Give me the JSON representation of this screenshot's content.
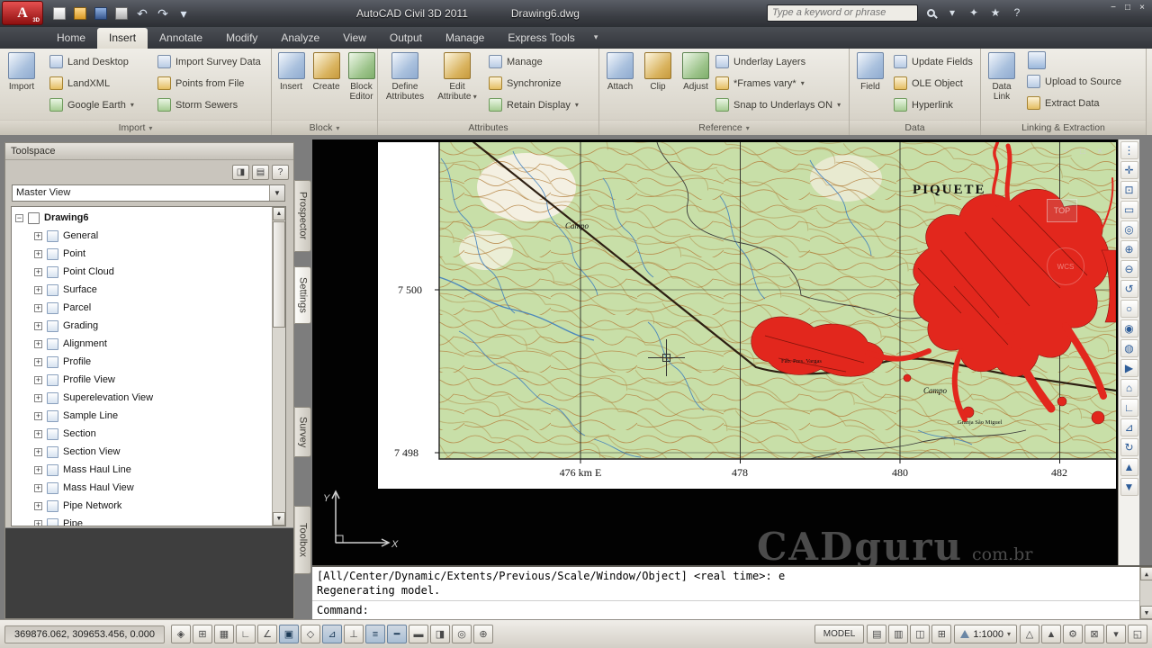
{
  "titlebar": {
    "app_title": "AutoCAD Civil 3D 2011",
    "doc_title": "Drawing6.dwg",
    "app_logo_letter": "A",
    "app_badge": "3D",
    "search_placeholder": "Type a keyword or phrase",
    "qat": [
      {
        "name": "qat-new-button",
        "kind": "new"
      },
      {
        "name": "qat-open-button",
        "kind": "open"
      },
      {
        "name": "qat-save-button",
        "kind": "save"
      },
      {
        "name": "qat-plot-button",
        "kind": "plot"
      },
      {
        "name": "qat-undo-button",
        "glyph": "↶"
      },
      {
        "name": "qat-redo-button",
        "glyph": "↷"
      },
      {
        "name": "qat-customize-caret",
        "glyph": "▾"
      }
    ],
    "infocenter": [
      {
        "name": "search-go-button",
        "kind": "mag"
      },
      {
        "name": "search-caret",
        "glyph": "▾"
      },
      {
        "name": "communication-center-button",
        "glyph": "✦"
      },
      {
        "name": "favorites-button",
        "glyph": "★"
      },
      {
        "name": "help-button",
        "glyph": "?"
      }
    ],
    "window_buttons": [
      {
        "name": "window-minimize-button",
        "glyph": "−"
      },
      {
        "name": "window-restore-button",
        "glyph": "□"
      },
      {
        "name": "window-close-button",
        "glyph": "×"
      }
    ]
  },
  "ribbon": {
    "tabs": [
      "Home",
      "Insert",
      "Annotate",
      "Modify",
      "Analyze",
      "View",
      "Output",
      "Manage",
      "Express Tools"
    ],
    "active_tab": "Insert",
    "panels": {
      "import": {
        "footer": "Import",
        "big": {
          "label": "Import"
        },
        "col1": [
          {
            "label": "Land Desktop"
          },
          {
            "label": "LandXML"
          },
          {
            "label": "Google Earth",
            "caret": true
          }
        ],
        "col2": [
          {
            "label": "Import Survey Data"
          },
          {
            "label": "Points from File"
          },
          {
            "label": "Storm Sewers"
          }
        ]
      },
      "block": {
        "footer": "Block",
        "bigs": [
          {
            "label": "Insert"
          },
          {
            "label": "Create"
          },
          {
            "label": "Block Editor"
          }
        ]
      },
      "attributes": {
        "footer": "Attributes",
        "bigs": [
          {
            "label": "Define Attributes"
          },
          {
            "label": "Edit Attribute",
            "caret": true
          }
        ],
        "col": [
          {
            "label": "Manage"
          },
          {
            "label": "Synchronize"
          },
          {
            "label": "Retain Display",
            "caret": true
          }
        ]
      },
      "reference": {
        "footer": "Reference",
        "bigs": [
          {
            "label": "Attach"
          },
          {
            "label": "Clip"
          },
          {
            "label": "Adjust"
          }
        ],
        "col": [
          {
            "label": "Underlay Layers"
          },
          {
            "label": "*Frames vary*",
            "caret": true
          },
          {
            "label": "Snap to Underlays ON",
            "caret": true
          }
        ]
      },
      "data": {
        "footer": "Data",
        "bigs": [
          {
            "label": "Field"
          }
        ],
        "col": [
          {
            "label": "Update Fields"
          },
          {
            "label": "OLE Object"
          },
          {
            "label": "Hyperlink"
          }
        ]
      },
      "linking": {
        "footer": "Linking & Extraction",
        "bigs": [
          {
            "label": "Data Link"
          }
        ],
        "col": [
          {
            "label": "Upload to Source"
          },
          {
            "label": "Extract Data"
          }
        ]
      }
    }
  },
  "toolspace": {
    "title": "Toolspace",
    "buttons": [
      {
        "name": "toolspace-autohide-button",
        "glyph": "◨"
      },
      {
        "name": "toolspace-properties-button",
        "glyph": "▤"
      },
      {
        "name": "toolspace-help-button",
        "glyph": "?"
      }
    ],
    "view_selector": "Master View",
    "root": "Drawing6",
    "items": [
      "General",
      "Point",
      "Point Cloud",
      "Surface",
      "Parcel",
      "Grading",
      "Alignment",
      "Profile",
      "Profile View",
      "Superelevation View",
      "Sample Line",
      "Section",
      "Section View",
      "Mass Haul Line",
      "Mass Haul View",
      "Pipe Network",
      "Pipe"
    ],
    "tabs": [
      {
        "label": "Prospector"
      },
      {
        "label": "Settings",
        "active": true
      },
      {
        "label": "Survey"
      },
      {
        "label": "Toolbox"
      }
    ]
  },
  "canvas": {
    "window_buttons": [
      {
        "name": "drawing-minimize-button",
        "glyph": "−"
      },
      {
        "name": "drawing-restore-button",
        "glyph": "□"
      },
      {
        "name": "drawing-close-button",
        "glyph": "×"
      }
    ],
    "viewcube_label": "TOP",
    "wcs_label": "WCS",
    "ucs_x": "X",
    "ucs_y": "Y",
    "watermark_main": "CADguru",
    "watermark_suffix": "com.br",
    "map": {
      "place_city": "PIQUETE",
      "place_campo_1": "Campo",
      "place_campo_2": "Campo",
      "place_granja": "Granja São Miguel",
      "place_vargas": "Fáb. Pres. Vargas",
      "grid_y_1": "7 500",
      "grid_y_2": "7 498",
      "grid_x_1": "476 km E",
      "grid_x_2": "478",
      "grid_x_3": "480",
      "grid_x_4": "482"
    }
  },
  "navbar": {
    "items": [
      {
        "name": "navbar-grip",
        "glyph": "⋮"
      },
      {
        "name": "pan-tool",
        "glyph": "✛"
      },
      {
        "name": "zoom-extents-tool",
        "glyph": "⊡"
      },
      {
        "name": "zoom-window-tool",
        "glyph": "▭"
      },
      {
        "name": "zoom-realtime-tool",
        "glyph": "◎"
      },
      {
        "name": "zoom-in-tool",
        "glyph": "⊕"
      },
      {
        "name": "zoom-out-tool",
        "glyph": "⊖"
      },
      {
        "name": "zoom-previous-tool",
        "glyph": "↺"
      },
      {
        "name": "orbit-tool",
        "glyph": "○"
      },
      {
        "name": "free-orbit-tool",
        "glyph": "◉"
      },
      {
        "name": "steering-wheel-tool",
        "glyph": "◍"
      },
      {
        "name": "show-motion-tool",
        "glyph": "▶"
      },
      {
        "name": "viewcube-home-tool",
        "glyph": "⌂"
      },
      {
        "name": "ucs-toggle-tool",
        "glyph": "∟"
      },
      {
        "name": "measure-tool",
        "glyph": "⊿"
      },
      {
        "name": "regen-tool",
        "glyph": "↻"
      },
      {
        "name": "scroll-up-button",
        "glyph": "▲"
      },
      {
        "name": "scroll-down-button",
        "glyph": "▼"
      }
    ]
  },
  "command": {
    "history_1": "[All/Center/Dynamic/Extents/Previous/Scale/Window/Object] <real time>: e",
    "history_2": "Regenerating model.",
    "prompt": "Command:"
  },
  "statusbar": {
    "coords": "369876.062, 309653.456, 0.000",
    "toggles": [
      {
        "name": "toggle-infer-constraints",
        "glyph": "◈",
        "active": false
      },
      {
        "name": "toggle-snap",
        "glyph": "⊞",
        "active": false
      },
      {
        "name": "toggle-grid",
        "glyph": "▦",
        "active": false
      },
      {
        "name": "toggle-ortho",
        "glyph": "∟",
        "active": false
      },
      {
        "name": "toggle-polar",
        "glyph": "∠",
        "active": false
      },
      {
        "name": "toggle-osnap",
        "glyph": "▣",
        "active": true
      },
      {
        "name": "toggle-3d-osnap",
        "glyph": "◇",
        "active": false
      },
      {
        "name": "toggle-otrack",
        "glyph": "⊿",
        "active": true
      },
      {
        "name": "toggle-ducs",
        "glyph": "⊥",
        "active": false
      },
      {
        "name": "toggle-dyn",
        "glyph": "≡",
        "active": true
      },
      {
        "name": "toggle-lwt",
        "glyph": "━",
        "active": true
      },
      {
        "name": "toggle-transparency",
        "glyph": "▬",
        "active": false
      },
      {
        "name": "toggle-quick-properties",
        "glyph": "◨",
        "active": false
      },
      {
        "name": "toggle-selection-cycling",
        "glyph": "◎",
        "active": false
      },
      {
        "name": "toggle-annotation-monitor",
        "glyph": "⊕",
        "active": false
      }
    ],
    "model_label": "MODEL",
    "right_icons_a": [
      {
        "name": "model-space-button",
        "glyph": "▤"
      },
      {
        "name": "layout-button",
        "glyph": "▥"
      },
      {
        "name": "quick-view-layouts-button",
        "glyph": "◫"
      },
      {
        "name": "quick-view-drawings-button",
        "glyph": "⊞"
      }
    ],
    "scale_label": "1:1000",
    "right_icons_b": [
      {
        "name": "annotation-visibility-button",
        "glyph": "△"
      },
      {
        "name": "autoscale-button",
        "glyph": "▲"
      },
      {
        "name": "workspace-switching-button",
        "glyph": "⚙"
      },
      {
        "name": "toolbar-lock-button",
        "glyph": "⊠"
      },
      {
        "name": "status-menu-caret",
        "glyph": "▾"
      },
      {
        "name": "clean-screen-button",
        "glyph": "◱"
      }
    ]
  }
}
